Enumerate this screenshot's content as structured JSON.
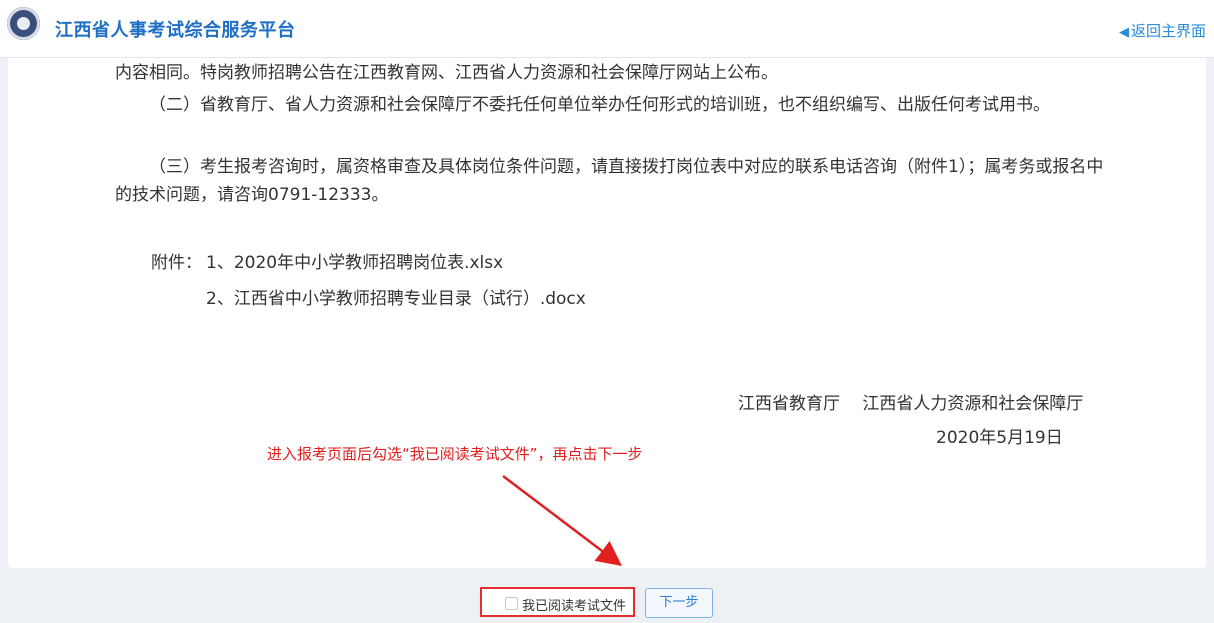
{
  "header": {
    "title": "江西省人事考试综合服务平台",
    "back_label": "返回主界面",
    "back_icon": "arrow-left-icon",
    "logo_icon": "emblem-logo"
  },
  "notice": {
    "p1": "内容相同。特岗教师招聘公告在江西教育网、江西省人力资源和社会保障厅网站上公布。",
    "p2": "（二）省教育厅、省人力资源和社会保障厅不委托任何单位举办任何形式的培训班，也不组织编写、出版任何考试用书。",
    "p3": "（三）考生报考咨询时，属资格审查及具体岗位条件问题，请直接拨打岗位表中对应的联系电话咨询（附件1）；属考务或报名中的技术问题，请咨询0791-12333。",
    "attachments_label": "附件：",
    "attachments": [
      "1、2020年中小学教师招聘岗位表.xlsx",
      "2、江西省中小学教师招聘专业目录（试行）.docx"
    ],
    "signature_org": "江西省教育厅　 江西省人力资源和社会保障厅",
    "signature_date": "2020年5月19日"
  },
  "annotation": {
    "text": "进入报考页面后勾选“我已阅读考试文件”，再点击下一步",
    "color": "#e02020"
  },
  "footer": {
    "agree_label": "我已阅读考试文件",
    "agree_checked": false,
    "next_label": "下一步"
  },
  "colors": {
    "title": "#1f6fc4",
    "link": "#2a8bd6",
    "highlight_border": "#e52e2e",
    "background": "#edf0f4"
  }
}
